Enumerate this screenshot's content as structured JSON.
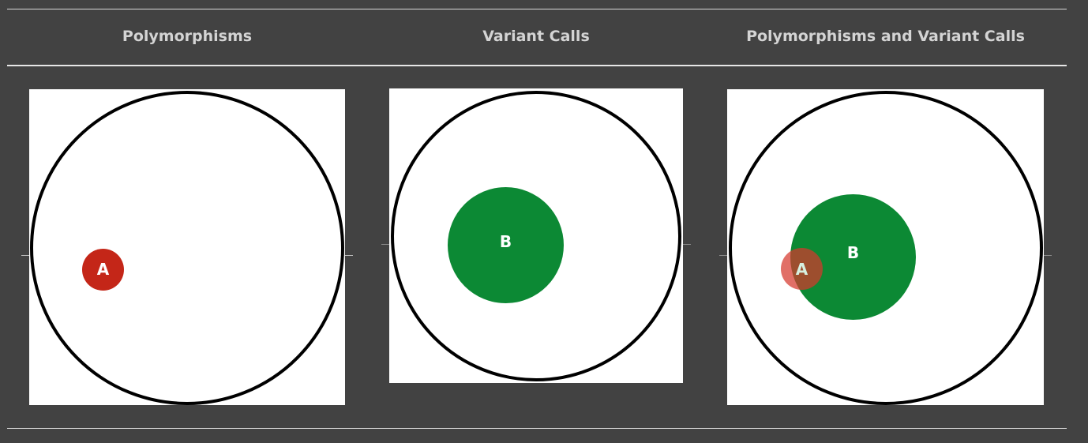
{
  "headers": {
    "polymorphisms": "Polymorphisms",
    "variant_calls": "Variant Calls",
    "combined": "Polymorphisms and Variant Calls"
  },
  "panels": {
    "polymorphisms": {
      "circles": [
        {
          "label": "A",
          "color": "#c42618"
        }
      ]
    },
    "variant_calls": {
      "circles": [
        {
          "label": "B",
          "color": "#0c8934"
        }
      ]
    },
    "combined": {
      "circles": [
        {
          "label": "B",
          "color": "#0c8934"
        },
        {
          "label": "A",
          "color": "#d6382c"
        }
      ]
    }
  },
  "colors": {
    "background": "#424242",
    "header_text": "#d4d4d4",
    "outer_circle": "#000000",
    "panel_background": "#ffffff"
  }
}
